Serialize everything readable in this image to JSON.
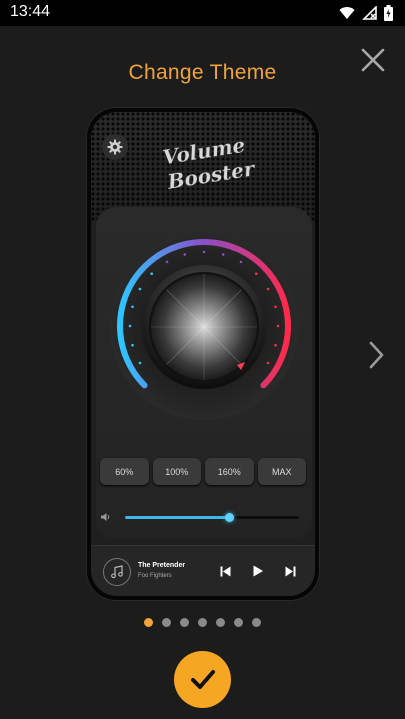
{
  "status_bar": {
    "time": "13:44",
    "icons": [
      "wifi-icon",
      "no-signal-icon",
      "battery-icon"
    ]
  },
  "header": {
    "title": "Change Theme"
  },
  "preview": {
    "logo": {
      "line1": "Volume",
      "line2": "Booster"
    },
    "presets": [
      "60%",
      "100%",
      "160%",
      "MAX"
    ],
    "volume_level": 0.6,
    "player": {
      "song": "The Pretender",
      "artist": "Foo Fighters"
    }
  },
  "pager": {
    "count": 7,
    "active": 0
  },
  "colors": {
    "accent": "#f0a33a",
    "dial_start": "#2ec6ff",
    "dial_mid": "#8a4fc8",
    "dial_end": "#ff2a4a"
  }
}
